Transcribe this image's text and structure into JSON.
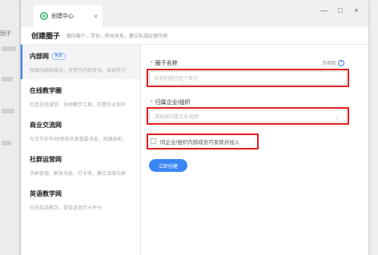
{
  "background": {
    "left_fragment": "团子"
  },
  "window": {
    "tab_title": "创建中心",
    "controls": {
      "minimize": "—",
      "maximize": "□",
      "close": "×"
    }
  },
  "header": {
    "title": "创建圈子",
    "subtitle": "面向客户、学员、粉丝关系，建立私域运营阵地"
  },
  "sidebar": {
    "items": [
      {
        "name": "内部网",
        "badge": "免费",
        "desc": "仅面向组织成员，可用于内部资讯、培训学习"
      },
      {
        "name": "在线教学圈",
        "badge": "",
        "desc": "打造在线课堂，多种教学工具，布置作业测评"
      },
      {
        "name": "商业交流网",
        "badge": "",
        "desc": "与合作伙伴/经销商共享重要消息，拓展商机"
      },
      {
        "name": "社群运营网",
        "badge": "",
        "desc": "多群管理、群发消息、打卡等，建立深度社群"
      },
      {
        "name": "英语教学网",
        "badge": "",
        "desc": "在线英语教学，提供语音打卡评分"
      }
    ]
  },
  "form": {
    "name_label": "圈子名称",
    "name_placeholder": "给你的圈子起个名字",
    "help_text": "示例库",
    "help_icon": "?",
    "org_label": "归属企业/组织",
    "org_placeholder": "请选择归属企业/组织",
    "chevron": "⌄",
    "checkbox_label": "同企业/组织内部成员可发现并加入",
    "submit_label": "立即创建"
  }
}
